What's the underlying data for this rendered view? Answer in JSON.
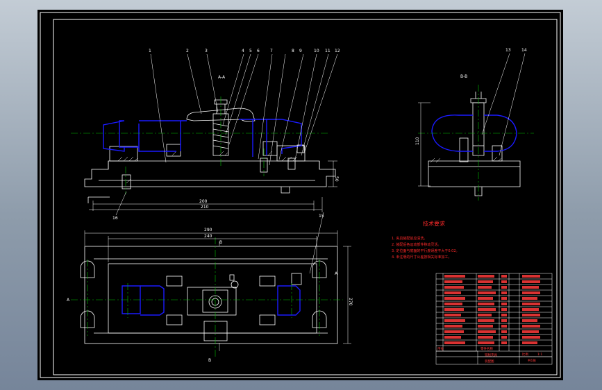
{
  "colors": {
    "background": "#000000",
    "outline": "#ffffff",
    "hidden_lines": "#1a1aff",
    "centerlines": "#00c000",
    "notes": "#ff2a2a"
  },
  "section_labels": {
    "section_aa": "A-A",
    "section_bb": "B-B",
    "view_a_left": "A",
    "view_a_right": "A",
    "view_b_top": "B",
    "view_b_bottom": "B"
  },
  "balloons_front": [
    "1",
    "2",
    "3",
    "4",
    "5",
    "6",
    "7",
    "8",
    "9",
    "10",
    "11",
    "12"
  ],
  "balloons_side": [
    "13",
    "14"
  ],
  "balloon_plan": "15",
  "balloon_bottom": "16",
  "dimensions": {
    "front_inner": "200",
    "front_outer": "210",
    "front_height": "50",
    "side_height": "110",
    "plan_overall": "290",
    "plan_inner": "240",
    "plan_height": "270"
  },
  "notes": {
    "title": "技术要求",
    "lines": [
      "1. 夹具装配前应清洗。",
      "2. 装配后各运动部件移动灵活。",
      "3. 定位面与底面的平行度误差不大于0.02。",
      "4. 未注明的尺寸公差按相关标准加工。"
    ]
  },
  "title_block": {
    "header_name": "零件名称",
    "header_seq": "序号",
    "drawing_name": "铣削夹具",
    "assembly": "装配图",
    "scale_label": "比例",
    "scale_value": "1:1",
    "sheet": "共1张"
  }
}
